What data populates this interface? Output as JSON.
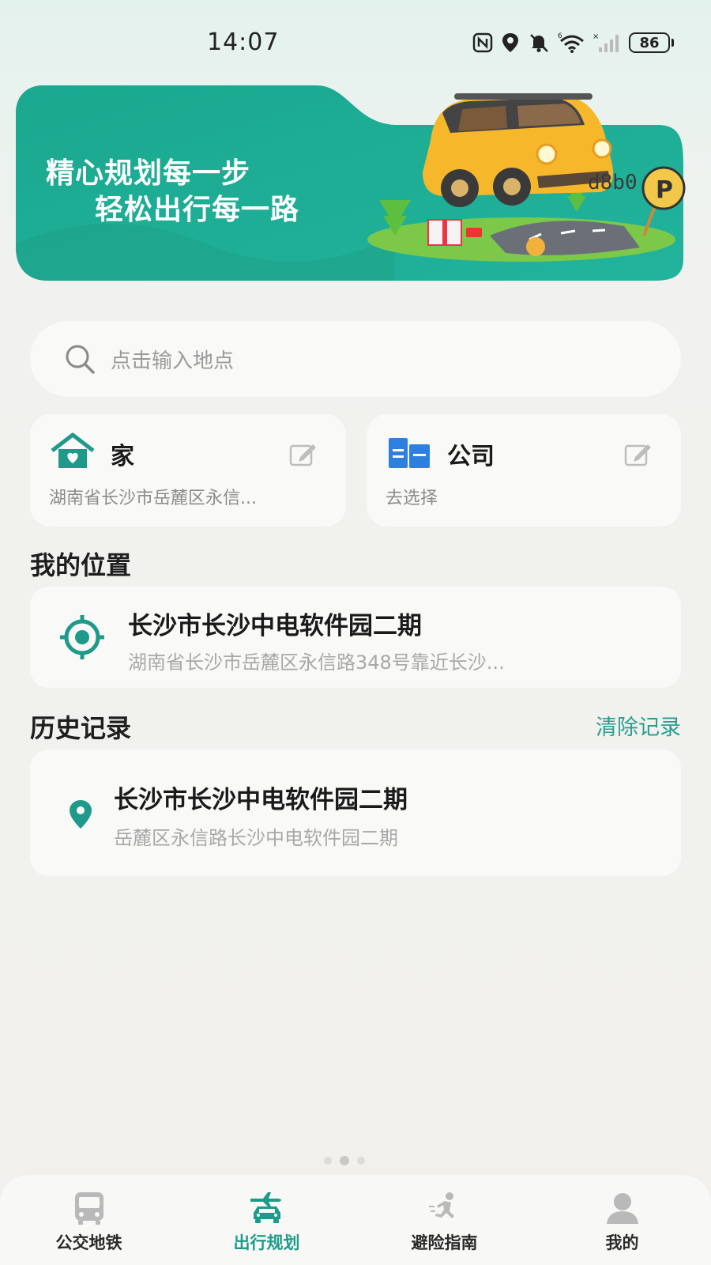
{
  "status_bar": {
    "time": "14:07",
    "battery": "86",
    "icons": [
      "nfc-icon",
      "location-icon",
      "mute-icon",
      "wifi-icon",
      "signal-icon",
      "battery-icon"
    ]
  },
  "banner": {
    "line1": "精心规划每一步",
    "line2": "轻松出行每一路",
    "overlay_code": "d8b0",
    "colors": {
      "background": "#1fa894",
      "text": "#ffffff"
    }
  },
  "search": {
    "placeholder": "点击输入地点",
    "icon": "search-icon"
  },
  "shortcuts": [
    {
      "title": "家",
      "subtitle": "湖南省长沙市岳麓区永信...",
      "icon": "home-icon",
      "edit_icon": "edit-icon"
    },
    {
      "title": "公司",
      "subtitle": "去选择",
      "icon": "building-icon",
      "edit_icon": "edit-icon"
    }
  ],
  "my_location": {
    "heading": "我的位置",
    "title": "长沙市长沙中电软件园二期",
    "address": "湖南省长沙市岳麓区永信路348号靠近长沙...",
    "icon": "target-location-icon"
  },
  "history": {
    "heading": "历史记录",
    "clear_label": "清除记录",
    "items": [
      {
        "title": "长沙市长沙中电软件园二期",
        "address": "岳麓区永信路长沙中电软件园二期",
        "icon": "map-pin-icon"
      }
    ]
  },
  "bottom_nav": {
    "items": [
      {
        "label": "公交地铁",
        "icon": "bus-icon",
        "active": false
      },
      {
        "label": "出行规划",
        "icon": "car-plane-icon",
        "active": true
      },
      {
        "label": "避险指南",
        "icon": "running-person-icon",
        "active": false
      },
      {
        "label": "我的",
        "icon": "profile-icon",
        "active": false
      }
    ]
  },
  "theme": {
    "accent": "#1f9a8a",
    "card_bg": "#f9f9f7",
    "muted_text": "#a8a8a8"
  }
}
